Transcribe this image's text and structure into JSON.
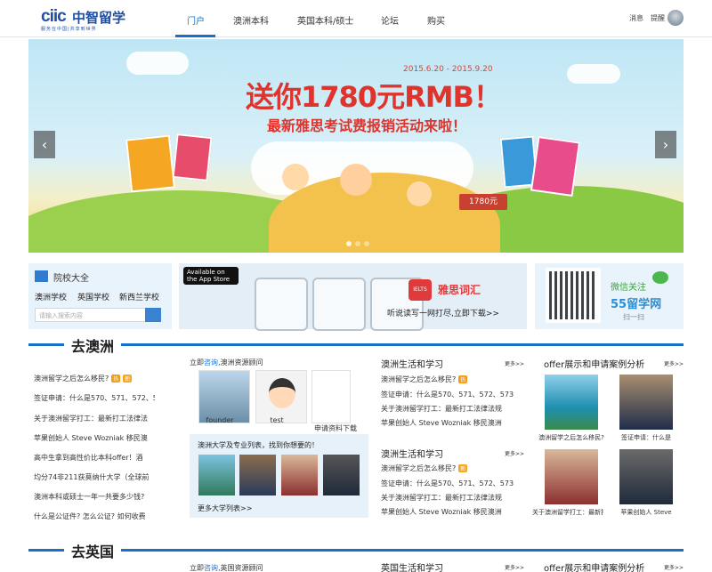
{
  "header": {
    "logo_mark": "ciic",
    "logo_text": "中智留学",
    "logo_slogan": "服务在中国|共享到世界",
    "nav": [
      "门户",
      "澳洲本科",
      "英国本科/硕士",
      "论坛",
      "购买"
    ],
    "messages": "消息",
    "reminders": "提醒"
  },
  "banner": {
    "date": "2015.6.20 - 2015.9.20",
    "title": "送你1780元RMB！",
    "subtitle": "最新雅思考试费报销活动来啦！",
    "tag": "1780元",
    "prev": "‹",
    "next": "›"
  },
  "school_panel": {
    "title": "院校大全",
    "links": [
      "澳洲学校",
      "英国学校",
      "新西兰学校"
    ],
    "search_placeholder": "请输入搜索内容"
  },
  "app_panel": {
    "store": "Available on the App Store",
    "ielts": "IELTS",
    "title": "雅思词汇",
    "subtitle": "听说读写一网打尽,立即下载>>"
  },
  "wechat_panel": {
    "title": "微信关注",
    "brand": "55留学网",
    "scan": "扫一扫"
  },
  "sections": {
    "australia": "去澳洲",
    "uk": "去英国"
  },
  "australia": {
    "left_list": [
      {
        "text": "澳洲留学之后怎么移民?",
        "hot": "热",
        "new": "新"
      },
      {
        "text": "签证申请：什么是570、571、572、5"
      },
      {
        "text": "关于澳洲留学打工：最新打工法律法"
      },
      {
        "text": "苹果创始人 Steve Wozniak 移民澳"
      },
      {
        "text": "高中生拿到高性价比本科offer！酒"
      },
      {
        "text": "均分74非211获莫纳什大学（全球前"
      },
      {
        "text": "澳洲本科或硕士一年一共要多少钱?"
      },
      {
        "text": "什么是公证件? 怎么公证? 如何收费"
      }
    ],
    "resource_prefix": "立即",
    "resource_link": "咨询",
    "resource_suffix": ",澳洲资源顾问",
    "resources": [
      "founder",
      "test",
      "申请资料下载"
    ],
    "uni_title": "澳洲大学及专业列表，找到你想要的！",
    "uni_more": "更多大学列表>>",
    "life_title_1": "澳洲生活和学习",
    "life_list_1": [
      "澳洲留学之后怎么移民?",
      "签证申请：什么是570、571、572、573",
      "关于澳洲留学打工：最新打工法律法规",
      "苹果创始人 Steve Wozniak 移民澳洲"
    ],
    "life_title_2": "澳洲生活和学习",
    "life_list_2": [
      "澳洲留学之后怎么移民?",
      "签证申请：什么是570、571、572、573",
      "关于澳洲留学打工：最新打工法律法规",
      "苹果创始人 Steve Wozniak 移民澳洲"
    ],
    "more": "更多>>",
    "offer_title": "offer展示和申请案例分析",
    "offer_caps": [
      "澳洲留学之后怎么移民?",
      "签证申请：什么是",
      "关于澳洲留学打工：最新打",
      "苹果创始人 Steve"
    ]
  },
  "uk": {
    "resource_prefix": "立即",
    "resource_link": "咨询",
    "resource_suffix": ",英国资源顾问",
    "life_title": "英国生活和学习",
    "more": "更多>>",
    "offer_title": "offer展示和申请案例分析"
  }
}
